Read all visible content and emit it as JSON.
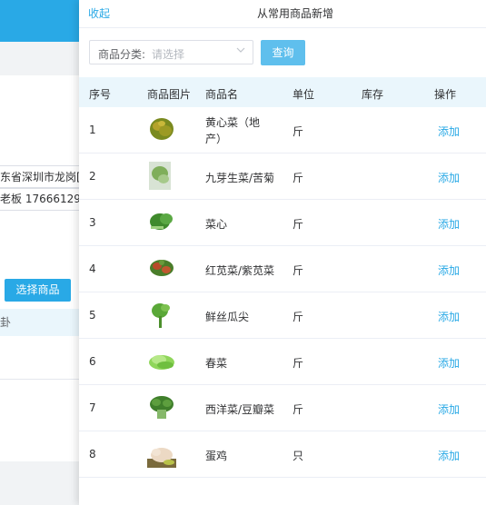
{
  "background": {
    "address_line1": "东省深圳市龙岗[",
    "address_line2": "老板 17666129:",
    "select_goods_button": "选择商品",
    "row_label": "卦"
  },
  "drawer": {
    "collapse_label": "收起",
    "title": "从常用商品新增",
    "filter_label": "商品分类:",
    "filter_placeholder": "请选择",
    "query_button": "查询"
  },
  "table": {
    "headers": {
      "index": "序号",
      "image": "商品图片",
      "name": "商品名",
      "unit": "单位",
      "stock": "库存",
      "action": "操作"
    },
    "rows": [
      {
        "index": "1",
        "name": "黄心菜（地产）",
        "unit": "斤",
        "action": "添加",
        "image_icon": "cabbage-image"
      },
      {
        "index": "2",
        "name": "九芽生菜/苦菊",
        "unit": "斤",
        "action": "添加",
        "image_icon": "lettuce-image"
      },
      {
        "index": "3",
        "name": "菜心",
        "unit": "斤",
        "action": "添加",
        "image_icon": "choy-sum-image"
      },
      {
        "index": "4",
        "name": "红苋菜/紫苋菜",
        "unit": "斤",
        "action": "添加",
        "image_icon": "amaranth-image"
      },
      {
        "index": "5",
        "name": "鲜丝瓜尖",
        "unit": "斤",
        "action": "添加",
        "image_icon": "loofah-shoots-image"
      },
      {
        "index": "6",
        "name": "春菜",
        "unit": "斤",
        "action": "添加",
        "image_icon": "spring-greens-image"
      },
      {
        "index": "7",
        "name": "西洋菜/豆瓣菜",
        "unit": "斤",
        "action": "添加",
        "image_icon": "watercress-image"
      },
      {
        "index": "8",
        "name": "蛋鸡",
        "unit": "只",
        "action": "添加",
        "image_icon": "chicken-image"
      }
    ]
  },
  "colors": {
    "accent": "#29a9e6",
    "header_bg": "#eaf6fc"
  }
}
